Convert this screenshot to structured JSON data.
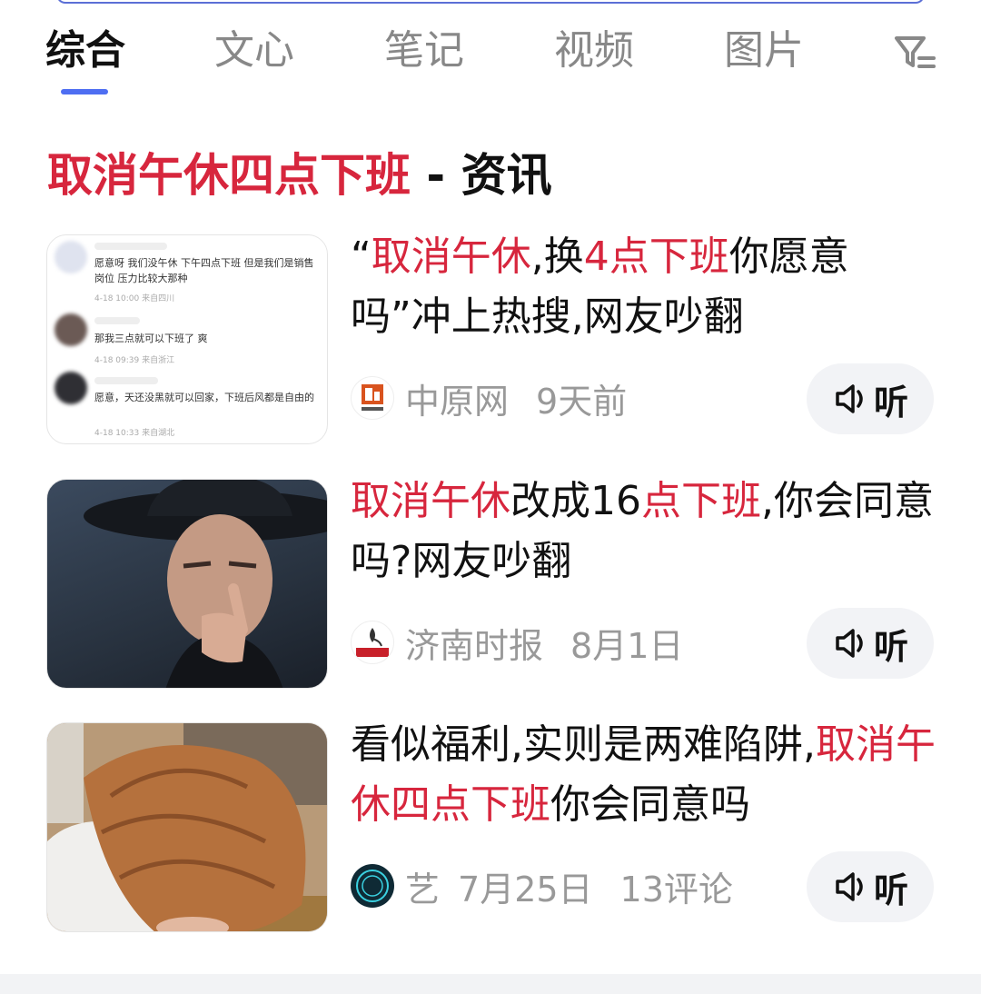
{
  "tabs": [
    {
      "label": "综合",
      "active": true
    },
    {
      "label": "文心",
      "active": false
    },
    {
      "label": "笔记",
      "active": false
    },
    {
      "label": "视频",
      "active": false
    },
    {
      "label": "图片",
      "active": false
    }
  ],
  "section": {
    "highlight": "取消午休四点下班",
    "separator": " - ",
    "suffix": "资讯"
  },
  "thumb1": {
    "comments": [
      {
        "text": "愿意呀 我们没午休 下午四点下班 但是我们是销售岗位 压力比较大那种",
        "meta": "4-18 10:00 来自四川"
      },
      {
        "text": "那我三点就可以下班了 爽",
        "meta": "4-18 09:39 来自浙江"
      },
      {
        "text": "愿意，天还没黑就可以回家，下班后风都是自由的",
        "meta": "4-18 10:33 来自湖北"
      }
    ]
  },
  "articles": [
    {
      "title_parts": [
        {
          "text": "“",
          "hl": false
        },
        {
          "text": "取消午休",
          "hl": true
        },
        {
          "text": ",换",
          "hl": false
        },
        {
          "text": "4点下班",
          "hl": true
        },
        {
          "text": "你愿意吗”冲上热搜,网友吵翻",
          "hl": false
        }
      ],
      "source": "中原网",
      "time": "9天前",
      "comments": "",
      "listen_label": "听"
    },
    {
      "title_parts": [
        {
          "text": "取消午休",
          "hl": true
        },
        {
          "text": "改成16",
          "hl": false
        },
        {
          "text": "点下班",
          "hl": true
        },
        {
          "text": ",你会同意吗?网友吵翻",
          "hl": false
        }
      ],
      "source": "济南时报",
      "time": "8月1日",
      "comments": "",
      "listen_label": "听"
    },
    {
      "title_parts": [
        {
          "text": "看似福利,实则是两难陷阱,",
          "hl": false
        },
        {
          "text": "取消午休四点下班",
          "hl": true
        },
        {
          "text": "你会同意吗",
          "hl": false
        }
      ],
      "source": "艺",
      "time": "7月25日",
      "comments": "13评论",
      "listen_label": "听"
    }
  ],
  "colors": {
    "highlight": "#d7263d",
    "tab_underline": "#4e6ef2",
    "muted": "#999999"
  }
}
